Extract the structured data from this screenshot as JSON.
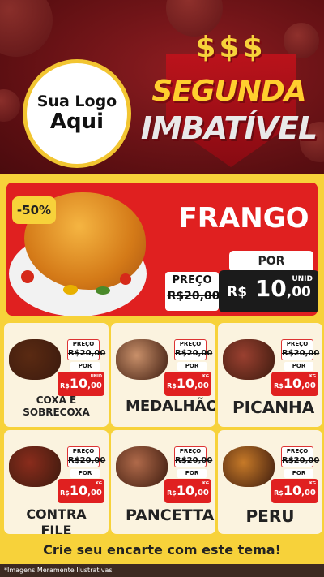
{
  "header": {
    "logo_line1": "Sua Logo",
    "logo_line2": "Aqui",
    "dollar_signs": "$$$",
    "title_line1": "SEGUNDA",
    "title_line2": "IMBATÍVEL"
  },
  "featured": {
    "discount": "-50%",
    "name": "FRANGO",
    "por_label": "POR",
    "preco_label": "PREÇO",
    "old_price": "R$20,00",
    "currency": "R$",
    "price_int": "10",
    "price_cents": ",00",
    "unit": "UNID"
  },
  "products": [
    {
      "name": "COXA E SOBRECOXA",
      "preco_label": "PREÇO",
      "old_price": "R$20,00",
      "por_label": "POR",
      "currency": "R$",
      "price_int": "10",
      "price_cents": ",00",
      "unit": "UNID",
      "icon": "pan-drumsticks-icon"
    },
    {
      "name": "MEDALHÃO",
      "preco_label": "PREÇO",
      "old_price": "R$20,00",
      "por_label": "POR",
      "currency": "R$",
      "price_int": "10",
      "price_cents": ",00",
      "unit": "KG",
      "icon": "medallion-skewers-icon"
    },
    {
      "name": "PICANHA",
      "preco_label": "PREÇO",
      "old_price": "R$20,00",
      "por_label": "POR",
      "currency": "R$",
      "price_int": "10",
      "price_cents": ",00",
      "unit": "KG",
      "icon": "sliced-picanha-icon"
    },
    {
      "name": "CONTRA FILE",
      "preco_label": "PREÇO",
      "old_price": "R$20,00",
      "por_label": "POR",
      "currency": "R$",
      "price_int": "10",
      "price_cents": ",00",
      "unit": "KG",
      "icon": "steak-icon"
    },
    {
      "name": "PANCETTA",
      "preco_label": "PREÇO",
      "old_price": "R$20,00",
      "por_label": "POR",
      "currency": "R$",
      "price_int": "10",
      "price_cents": ",00",
      "unit": "KG",
      "icon": "pancetta-board-icon"
    },
    {
      "name": "PERU",
      "preco_label": "PREÇO",
      "old_price": "R$20,00",
      "por_label": "POR",
      "currency": "R$",
      "price_int": "10",
      "price_cents": ",00",
      "unit": "KG",
      "icon": "roast-turkey-icon"
    }
  ],
  "footer": {
    "cta": "Crie seu encarte com este tema!",
    "note": "*Imagens Meramente Ilustrativas"
  },
  "colors": {
    "header_bg": "#5d0f12",
    "page_bg": "#f7d23a",
    "feature_bg": "#e02020",
    "price_dark": "#1b1b1b",
    "card_bg": "#fbf3df"
  }
}
